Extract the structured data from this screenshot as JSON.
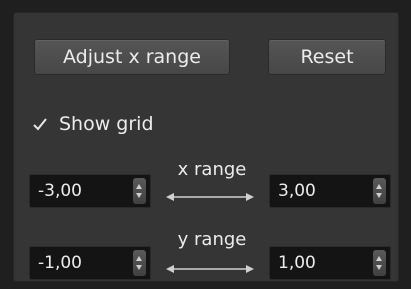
{
  "buttons": {
    "adjust_label": "Adjust x range",
    "reset_label": "Reset"
  },
  "grid": {
    "label": "Show grid",
    "checked": true
  },
  "x_range": {
    "label": "x range",
    "min": "-3,00",
    "max": "3,00"
  },
  "y_range": {
    "label": "y range",
    "min": "-1,00",
    "max": "1,00"
  },
  "colors": {
    "panel": "#353535",
    "button": "#4d4d4d",
    "field": "#141414",
    "text": "#ececec"
  },
  "icons": {
    "check": "check-icon",
    "spin": "spin-arrows-icon",
    "range_arrow": "double-arrow-icon"
  }
}
